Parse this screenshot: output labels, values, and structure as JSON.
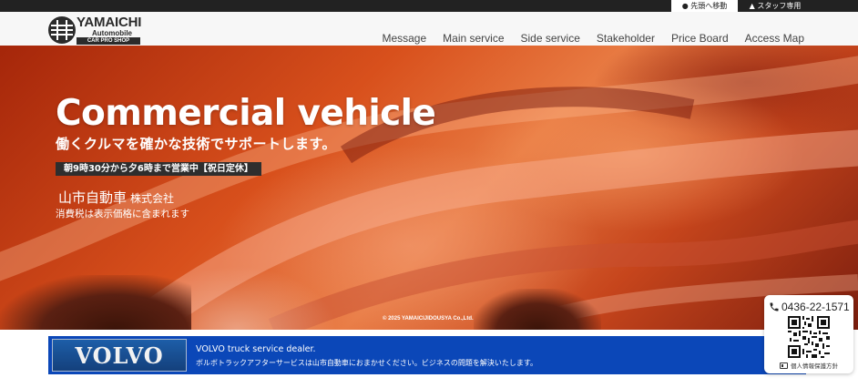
{
  "topbar": {
    "to_top_label": "● 先頭へ移動",
    "staff_label": "▲ スタッフ専用"
  },
  "logo": {
    "name": "YAMAICHI",
    "sub": "Automobile",
    "shop": "CAR PRO SHOP"
  },
  "nav": {
    "items": [
      {
        "label": "Message"
      },
      {
        "label": "Main service"
      },
      {
        "label": "Side service"
      },
      {
        "label": "Stakeholder"
      },
      {
        "label": "Price Board"
      },
      {
        "label": "Access Map"
      }
    ]
  },
  "hero": {
    "title": "Commercial vehicle",
    "subtitle": "働くクルマを確かな技術でサポートします。",
    "hours": "朝9時30分から夕6時まで営業中【祝日定休】",
    "company_name": "山市自動車",
    "company_suffix": "株式会社",
    "tax_note": "消費税は表示価格に含まれます",
    "copyright": "© 2025 YAMAICIJIDOUSYA Co.,Ltd."
  },
  "banner": {
    "logo_text": "VOLVO",
    "title": "VOLVO truck service dealer.",
    "description": "ボルボトラックアフターサービスは山市自動車におまかせください。ビジネスの問題を解決いたします。"
  },
  "contact": {
    "phone": "0436-22-1571",
    "privacy_label": "個人情報保護方針"
  },
  "colors": {
    "topbar": "#222222",
    "banner": "#0b47b8",
    "hero_accent": "#d8501c"
  }
}
